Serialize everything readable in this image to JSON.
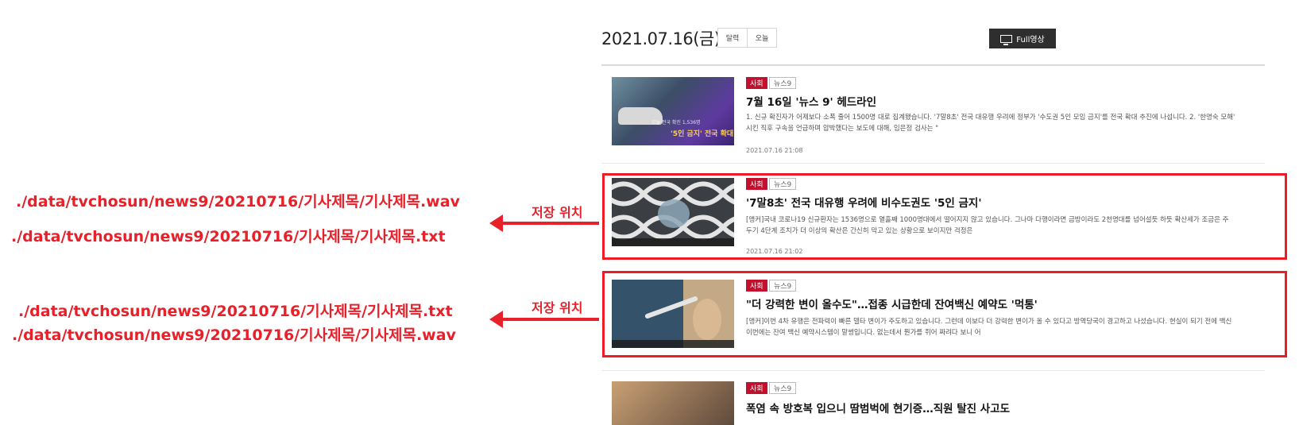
{
  "header": {
    "date": "2021.07.16(금)",
    "calendar_label": "달력",
    "today_label": "오늘",
    "full_video_label": "Full영상"
  },
  "articles": [
    {
      "category": "사회",
      "program": "뉴스9",
      "title": "7월 16일 '뉴스 9' 헤드라인",
      "summary_line1": "1. 신규 확진자가 어제보다 소폭 줄어 1500명 대로 집계됐습니다. '7말8초' 전국 대유행 우려에 정부가 '수도권 5인 모임 금지'를 전국 확대 추진에 나섭니다. 2. '한명숙 모해'",
      "summary_line2": "시킨 직후 구속을 언급하며 압박했다는 보도에 대해, 임은정 검사는 \"",
      "date": "2021.07.16 21:08",
      "thumb_caption": "'5인 금지' 전국 확대",
      "thumb_sub": "오늘 전국 확진 1,536명"
    },
    {
      "category": "사회",
      "program": "뉴스9",
      "title": "'7말8초' 전국 대유행 우려에 비수도권도 '5인 금지'",
      "summary_line1": "[앵커]국내 코로나19 신규환자는 1536명으로 열흘째 1000명대에서 떨어지지 않고 있습니다. 그나마 다행이라면 금방이라도 2천명대를 넘어설듯 하듯 확산세가 조금은 주",
      "summary_line2": "두기 4단계 조치가 더 이상의 확산은 간신히 막고 있는 상황으로 보이지만 걱정은",
      "date": "2021.07.16 21:02"
    },
    {
      "category": "사회",
      "program": "뉴스9",
      "title": "\"더 강력한 변이 올수도\"…접종 시급한데 잔여백신 예약도 '먹통'",
      "summary_line1": "[앵커]이번 4차 유행은 전파력이 빠른 델타 변이가 주도하고 있습니다. 그런데 이보다 더 강력한 변이가 올 수 있다고 방역당국이 경고하고 나섰습니다. 현실이 되기 전에 백신",
      "summary_line2": "이번에는 잔여 백신 예약시스템이 말썽입니다. 없는데서 뭔가를 쥐어 짜려다 보니 어",
      "date": ""
    },
    {
      "category": "사회",
      "program": "뉴스9",
      "title": "폭염 속 방호복 입으니 땀범벅에 현기증…직원 탈진 사고도"
    }
  ],
  "annotations": [
    {
      "label": "저장 위치",
      "path_first": "./data/tvchosun/news9/20210716/기사제목/기사제목.wav",
      "path_second": "./data/tvchosun/news9/20210716/기사제목/기사제목.txt"
    },
    {
      "label": "저장 위치",
      "path_first": "./data/tvchosun/news9/20210716/기사제목/기사제목.txt",
      "path_second": "./data/tvchosun/news9/20210716/기사제목/기사제목.wav"
    }
  ],
  "colors": {
    "highlight": "#ee1c25",
    "category_tag": "#c2102e",
    "full_button": "#2e2e2e"
  }
}
